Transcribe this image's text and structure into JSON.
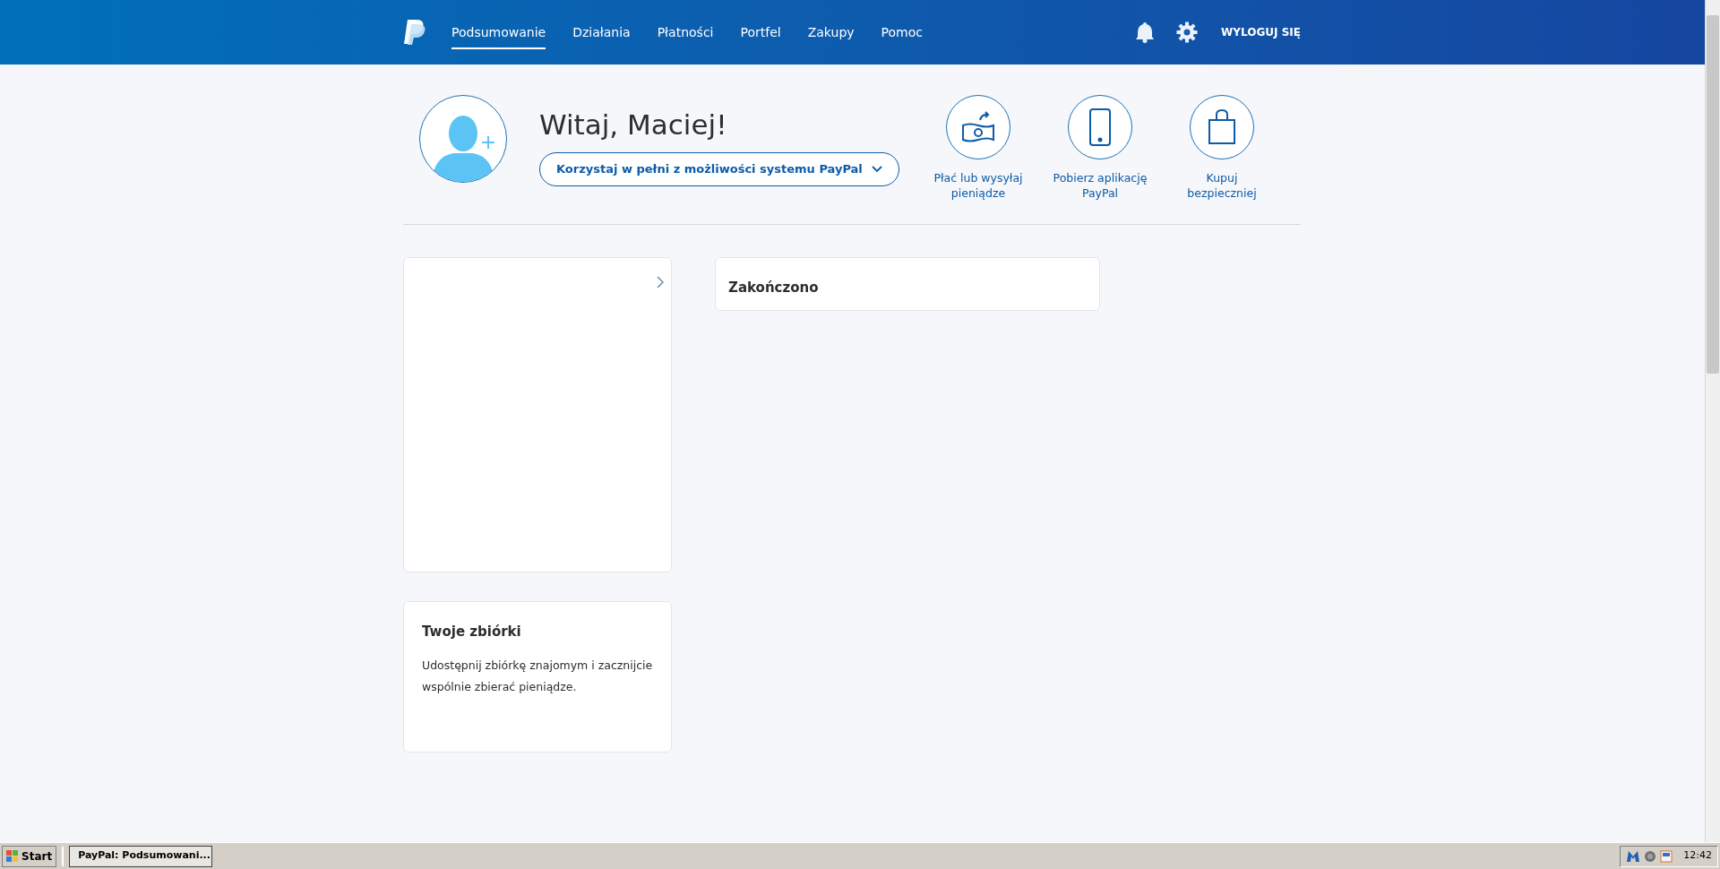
{
  "nav": {
    "items": [
      {
        "label": "Podsumowanie",
        "selected": true
      },
      {
        "label": "Działania",
        "selected": false
      },
      {
        "label": "Płatności",
        "selected": false
      },
      {
        "label": "Portfel",
        "selected": false
      },
      {
        "label": "Zakupy",
        "selected": false
      },
      {
        "label": "Pomoc",
        "selected": false
      }
    ],
    "logout": "WYLOGUJ SIĘ"
  },
  "profile": {
    "greeting": "Witaj, Maciej!",
    "button": "Korzystaj w pełni z możliwości systemu PayPal"
  },
  "quick_actions": [
    {
      "kind": "send",
      "label": "Płać lub wysyłaj pieniądze"
    },
    {
      "kind": "app",
      "label": "Pobierz aplikację PayPal"
    },
    {
      "kind": "shop",
      "label": "Kupuj bezpieczniej"
    }
  ],
  "status_card": {
    "title": "Zakończono"
  },
  "collections_card": {
    "title": "Twoje zbiórki",
    "text": "Udostępnij zbiórkę znajomym i zacznijcie wspólnie zbierać pieniądze."
  },
  "taskbar": {
    "start": "Start",
    "tasks": [
      {
        "label": "PayPal: Podsumowani...",
        "selected": true
      }
    ],
    "clock": "12:42"
  }
}
